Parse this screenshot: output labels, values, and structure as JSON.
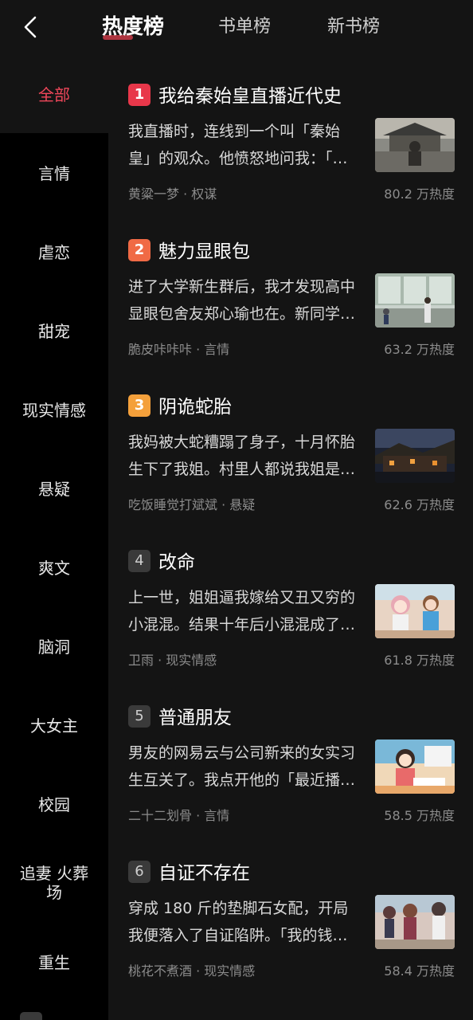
{
  "header": {
    "tabs": [
      "热度榜",
      "书单榜",
      "新书榜"
    ]
  },
  "sidebar": {
    "items": [
      {
        "label": "全部"
      },
      {
        "label": "言情"
      },
      {
        "label": "虐恋"
      },
      {
        "label": "甜宠"
      },
      {
        "label": "现实情感"
      },
      {
        "label": "悬疑"
      },
      {
        "label": "爽文"
      },
      {
        "label": "脑洞"
      },
      {
        "label": "大女主"
      },
      {
        "label": "校园"
      },
      {
        "label": "追妻 火葬场"
      },
      {
        "label": "重生"
      }
    ]
  },
  "books": [
    {
      "rank": "1",
      "title": "我给秦始皇直播近代史",
      "desc": "我直播时，连线到一个叫「秦始皇」的观众。他愤怒地问我：「…",
      "meta": "黄粱一梦 · 权谋",
      "heat": "80.2 万热度"
    },
    {
      "rank": "2",
      "title": "魅力显眼包",
      "desc": "进了大学新生群后，我才发现高中显眼包舍友郑心瑜也在。新同学…",
      "meta": "脆皮咔咔咔 · 言情",
      "heat": "63.2 万热度"
    },
    {
      "rank": "3",
      "title": "阴诡蛇胎",
      "desc": "我妈被大蛇糟蹋了身子，十月怀胎生下了我姐。村里人都说我姐是…",
      "meta": "吃饭睡觉打斌斌 · 悬疑",
      "heat": "62.6 万热度"
    },
    {
      "rank": "4",
      "title": "改命",
      "desc": "上一世，姐姐逼我嫁给又丑又穷的小混混。结果十年后小混混成了…",
      "meta": "卫雨 · 现实情感",
      "heat": "61.8 万热度"
    },
    {
      "rank": "5",
      "title": "普通朋友",
      "desc": "男友的网易云与公司新来的女实习生互关了。我点开他的「最近播…",
      "meta": "二十二划骨 · 言情",
      "heat": "58.5 万热度"
    },
    {
      "rank": "6",
      "title": "自证不存在",
      "desc": "穿成 180 斤的垫脚石女配，开局我便落入了自证陷阱。「我的钱…",
      "meta": "桃花不煮酒 · 现实情感",
      "heat": "58.4 万热度"
    }
  ],
  "colors": {
    "accent": "#f0475a",
    "rank1": "#e8374a",
    "rank2": "#f06a45",
    "rank3": "#f4a03b"
  }
}
